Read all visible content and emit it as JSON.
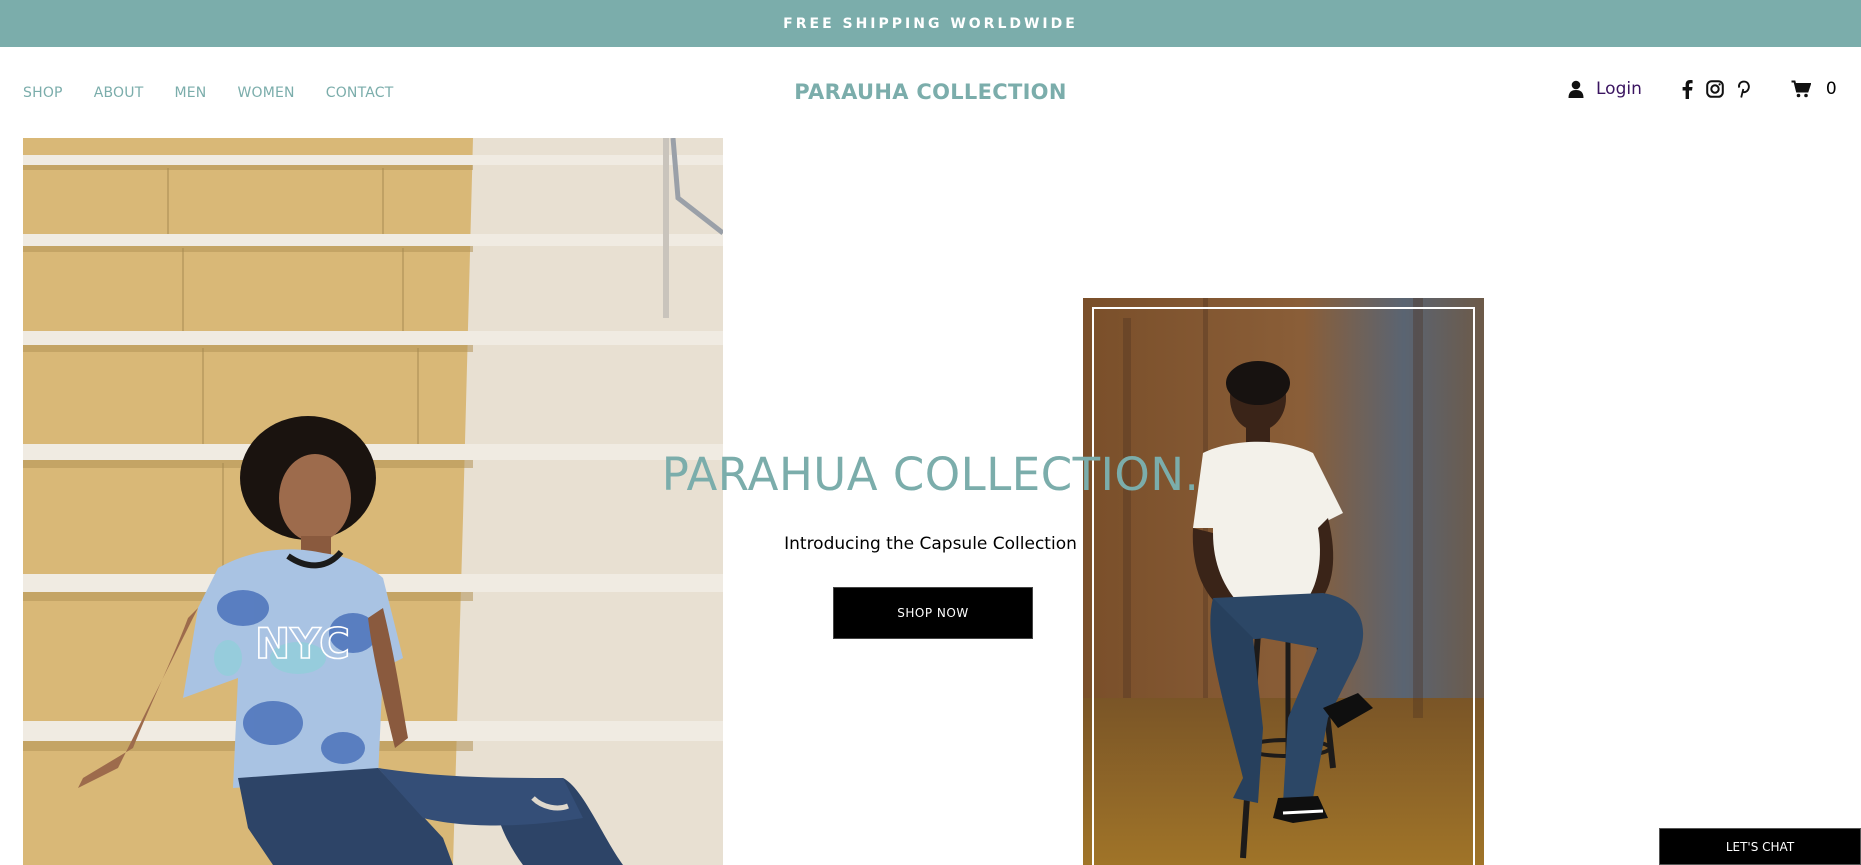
{
  "announcement": {
    "text": "FREE SHIPPING WORLDWIDE"
  },
  "header": {
    "nav": [
      {
        "label": "SHOP"
      },
      {
        "label": "ABOUT"
      },
      {
        "label": "MEN"
      },
      {
        "label": "WOMEN"
      },
      {
        "label": "CONTACT"
      }
    ],
    "brand": "PARAUHA COLLECTION",
    "login_label": "Login",
    "cart_count": "0",
    "icons": [
      "user-icon",
      "facebook-icon",
      "instagram-icon",
      "pinterest-icon",
      "cart-icon"
    ]
  },
  "hero": {
    "title": "PARAHUA COLLECTION.",
    "subtitle": "Introducing the Capsule Collection",
    "cta_label": "SHOP NOW"
  },
  "chat": {
    "label": "LET'S CHAT"
  },
  "colors": {
    "accent": "#7badab",
    "login": "#3a1460",
    "button": "#000000"
  }
}
